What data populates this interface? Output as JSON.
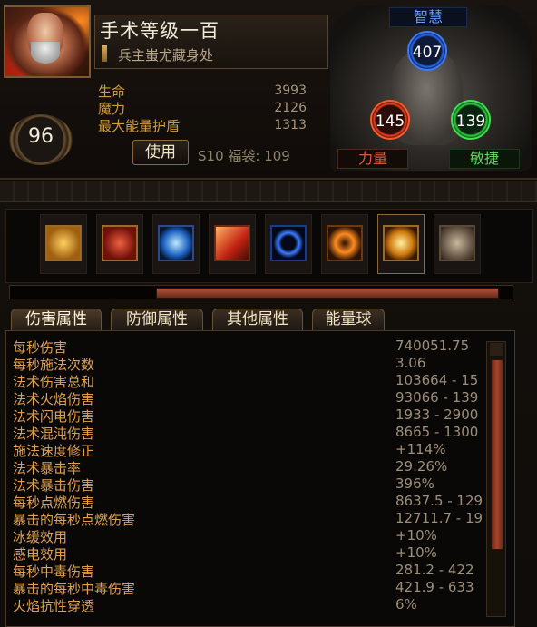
{
  "character": {
    "name": "手术等级一百",
    "league_title": "兵主蚩尤藏身处",
    "level": "96",
    "use_button": "使用",
    "season_info": "S10 福袋: 109",
    "stats": [
      {
        "label": "生命",
        "value": "3993"
      },
      {
        "label": "魔力",
        "value": "2126"
      },
      {
        "label": "最大能量护盾",
        "value": "1313"
      }
    ]
  },
  "attributes": {
    "intelligence": {
      "label": "智慧",
      "value": "407",
      "color": "#3a7cff"
    },
    "strength": {
      "label": "力量",
      "value": "145",
      "color": "#ff5a2a"
    },
    "dexterity": {
      "label": "敏捷",
      "value": "139",
      "color": "#40e050"
    }
  },
  "skills": [
    {
      "icon": "golden-cube-skill-icon",
      "color": "#d9a030"
    },
    {
      "icon": "red-fist-skill-icon",
      "color": "#c03020"
    },
    {
      "icon": "blue-lightning-skill-icon",
      "color": "#3aa0ff"
    },
    {
      "icon": "red-runner-skill-icon",
      "color": "#e04028"
    },
    {
      "icon": "blue-portal-skill-icon",
      "color": "#2060ff"
    },
    {
      "icon": "orange-chain-skill-icon",
      "color": "#ff8a20"
    },
    {
      "icon": "gold-nova-skill-icon",
      "color": "#f0b040"
    },
    {
      "icon": "stone-shrine-skill-icon",
      "color": "#8a7a6a"
    }
  ],
  "experience": {
    "progress": 0.68
  },
  "tabs": [
    {
      "label": "伤害属性",
      "active": true
    },
    {
      "label": "防御属性",
      "active": false
    },
    {
      "label": "其他属性",
      "active": false
    },
    {
      "label": "能量球",
      "active": false
    }
  ],
  "damage_stats": [
    {
      "label": "每秒伤害",
      "value": "740051.75"
    },
    {
      "label": "每秒施法次数",
      "value": "3.06"
    },
    {
      "label": "法术伤害总和",
      "value": "103664 - 15"
    },
    {
      "label": "法术火焰伤害",
      "value": "93066 - 139"
    },
    {
      "label": "法术闪电伤害",
      "value": "1933 - 2900"
    },
    {
      "label": "法术混沌伤害",
      "value": "8665 - 1300"
    },
    {
      "label": "施法速度修正",
      "value": "+114%"
    },
    {
      "label": "法术暴击率",
      "value": "29.26%"
    },
    {
      "label": "法术暴击伤害",
      "value": "396%"
    },
    {
      "label": "每秒点燃伤害",
      "value": "8637.5 - 129"
    },
    {
      "label": "暴击的每秒点燃伤害",
      "value": "12711.7 - 19"
    },
    {
      "label": "冰缓效用",
      "value": "+10%"
    },
    {
      "label": "感电效用",
      "value": "+10%"
    },
    {
      "label": "每秒中毒伤害",
      "value": "281.2 - 422"
    },
    {
      "label": "暴击的每秒中毒伤害",
      "value": "421.9 - 633"
    },
    {
      "label": "火焰抗性穿透",
      "value": "6%"
    }
  ]
}
